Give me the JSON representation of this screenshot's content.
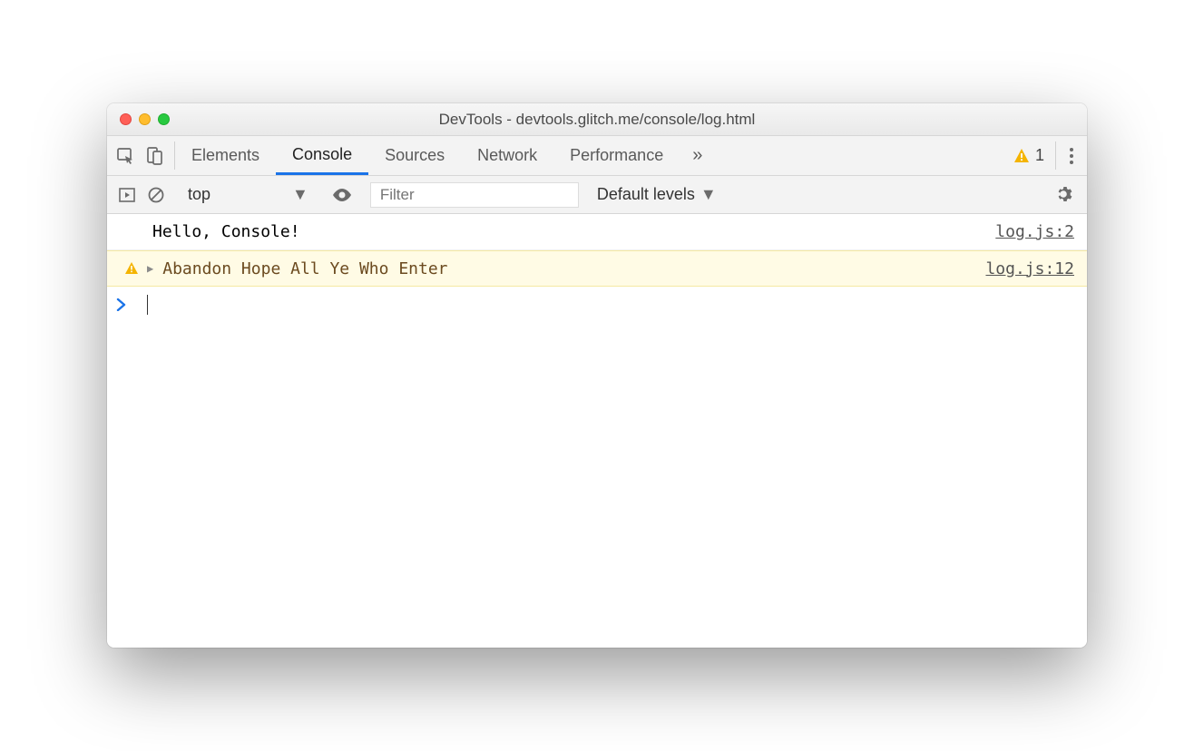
{
  "window": {
    "title": "DevTools - devtools.glitch.me/console/log.html"
  },
  "tabs": {
    "items": [
      "Elements",
      "Console",
      "Sources",
      "Network",
      "Performance"
    ],
    "active": "Console",
    "more_glyph": "»"
  },
  "warnings": {
    "count": "1"
  },
  "toolbar": {
    "context": "top",
    "filter_placeholder": "Filter",
    "levels_label": "Default levels"
  },
  "console": {
    "rows": [
      {
        "type": "log",
        "message": "Hello, Console!",
        "source": "log.js:2"
      },
      {
        "type": "warn",
        "message": "Abandon Hope All Ye Who Enter",
        "source": "log.js:12"
      }
    ],
    "prompt": "›"
  }
}
